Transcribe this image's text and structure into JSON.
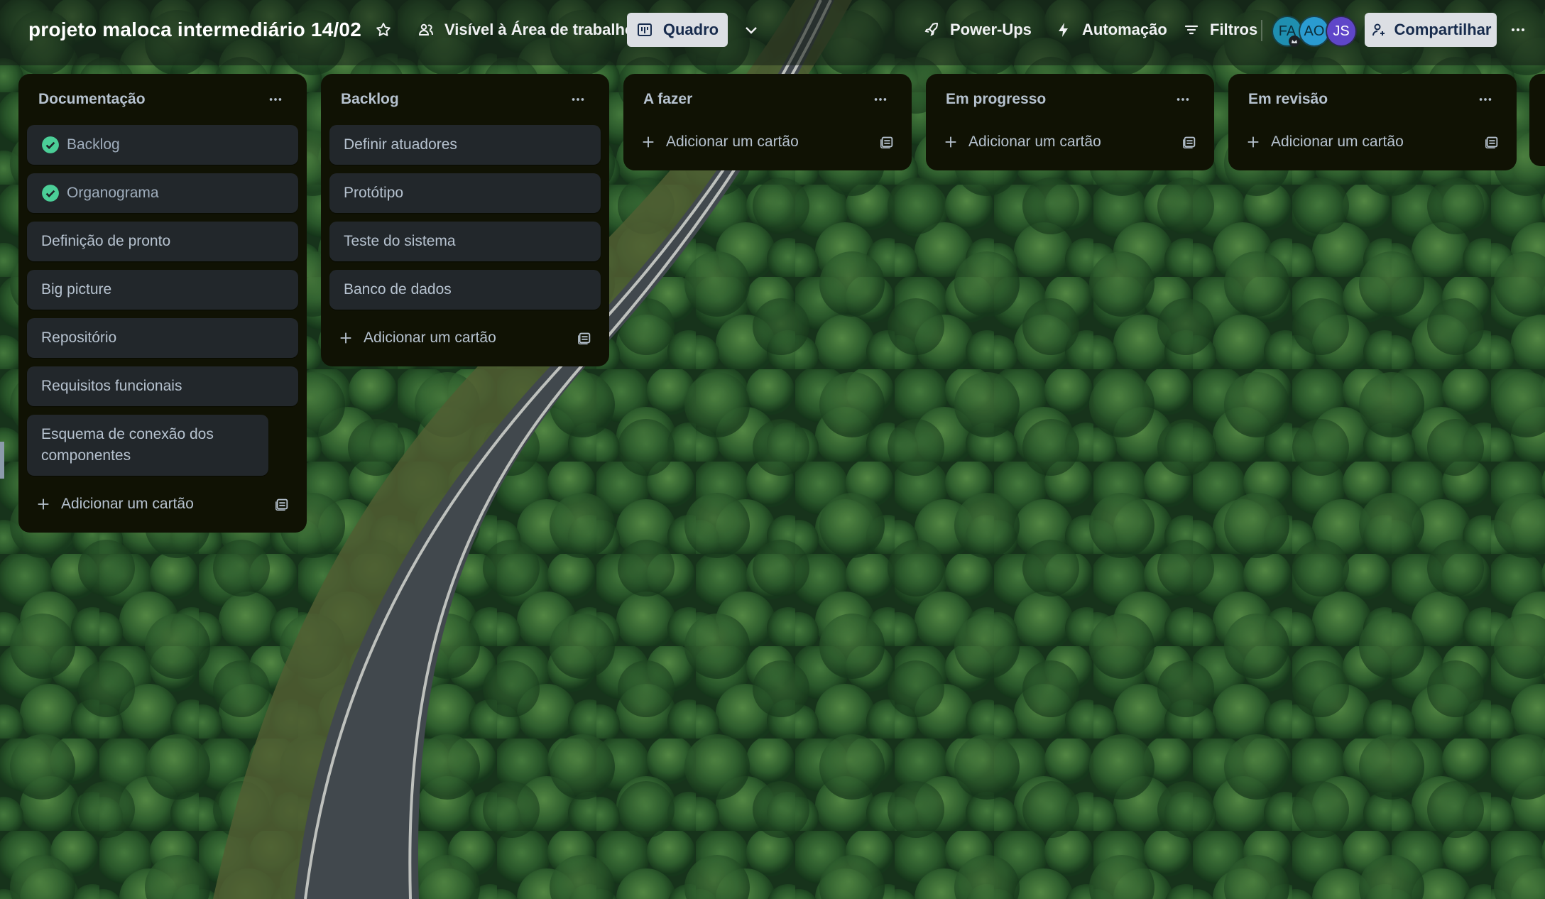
{
  "board": {
    "title": "projeto maloca intermediário 14/02",
    "visibility_label": "Visível à Área de trabalho",
    "view_label": "Quadro"
  },
  "topbar": {
    "powerups_label": "Power-Ups",
    "automation_label": "Automação",
    "filters_label": "Filtros",
    "share_label": "Compartilhar",
    "members": [
      {
        "initials": "FA",
        "color": "#1f8fb0"
      },
      {
        "initials": "AO",
        "color": "#2a9bd1"
      },
      {
        "initials": "JS",
        "color": "#5f46c9"
      }
    ]
  },
  "lists": [
    {
      "title": "Documentação",
      "cards": [
        {
          "title": "Backlog",
          "complete": true
        },
        {
          "title": "Organograma",
          "complete": true
        },
        {
          "title": "Definição de pronto",
          "complete": false
        },
        {
          "title": "Big picture",
          "complete": false
        },
        {
          "title": "Repositório",
          "complete": false
        },
        {
          "title": "Requisitos funcionais",
          "complete": false
        },
        {
          "title": "Esquema de conexão dos componentes",
          "complete": false
        }
      ],
      "add_label": "Adicionar um cartão"
    },
    {
      "title": "Backlog",
      "cards": [
        {
          "title": "Definir atuadores",
          "complete": false
        },
        {
          "title": "Protótipo",
          "complete": false
        },
        {
          "title": "Teste do sistema",
          "complete": false
        },
        {
          "title": "Banco de dados",
          "complete": false
        }
      ],
      "add_label": "Adicionar um cartão"
    },
    {
      "title": "A fazer",
      "cards": [],
      "add_label": "Adicionar um cartão"
    },
    {
      "title": "Em progresso",
      "cards": [],
      "add_label": "Adicionar um cartão"
    },
    {
      "title": "Em revisão",
      "cards": [],
      "add_label": "Adicionar um cartão"
    }
  ],
  "colors": {
    "list_bg": "#101204",
    "card_bg": "#22272b",
    "text": "#b6c2cf",
    "complete_green": "#4bce97",
    "button_bg": "#dcdfe4"
  }
}
